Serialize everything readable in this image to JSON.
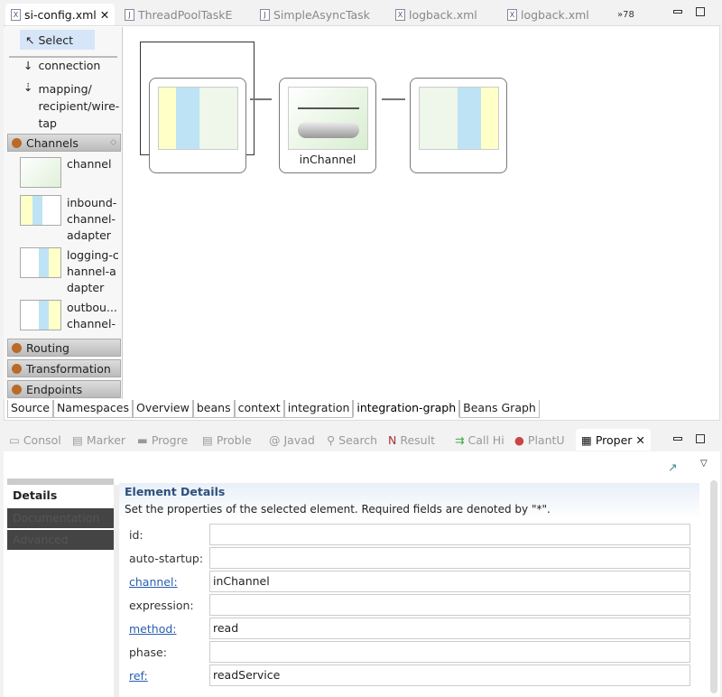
{
  "editor_tabs": [
    {
      "label": "si-config.xml",
      "active": true
    },
    {
      "label": "ThreadPoolTaskE"
    },
    {
      "label": "SimpleAsyncTask"
    },
    {
      "label": "logback.xml"
    },
    {
      "label": "logback.xml"
    }
  ],
  "overflow_count": "»78",
  "palette": {
    "select": "Select",
    "connection": "connection",
    "mapping": "mapping/ recipient/wire-tap",
    "channels_drawer": "Channels",
    "items": [
      "channel",
      "inbound-channel-adapter",
      "logging-channel-adapter",
      "outbou... channel-"
    ],
    "drawers": [
      "Routing",
      "Transformation",
      "Endpoints"
    ]
  },
  "canvas": {
    "nodes": [
      {
        "label": ""
      },
      {
        "label": "inChannel"
      },
      {
        "label": ""
      }
    ]
  },
  "bottom_tabs": [
    "Source",
    "Namespaces",
    "Overview",
    "beans",
    "context",
    "integration",
    "integration-graph",
    "Beans Graph"
  ],
  "active_bottom_tab": "integration-graph",
  "view_tabs": [
    "Consol",
    "Marker",
    "Progre",
    "Proble",
    "Javad",
    "Search",
    "Result",
    "Call Hi",
    "PlantU",
    "Proper"
  ],
  "properties": {
    "side_tabs": [
      "Details",
      "Documentation",
      "Advanced"
    ],
    "section_title": "Element Details",
    "description": "Set the properties of the selected element. Required fields are denoted by \"*\".",
    "fields": [
      {
        "label": "id:",
        "value": "",
        "link": false
      },
      {
        "label": "auto-startup:",
        "value": "",
        "link": false
      },
      {
        "label": "channel:",
        "value": "inChannel",
        "link": true
      },
      {
        "label": "expression:",
        "value": "",
        "link": false
      },
      {
        "label": "method:",
        "value": "read",
        "link": true
      },
      {
        "label": "phase:",
        "value": "",
        "link": false
      },
      {
        "label": "ref:",
        "value": "readService",
        "link": true
      }
    ]
  }
}
